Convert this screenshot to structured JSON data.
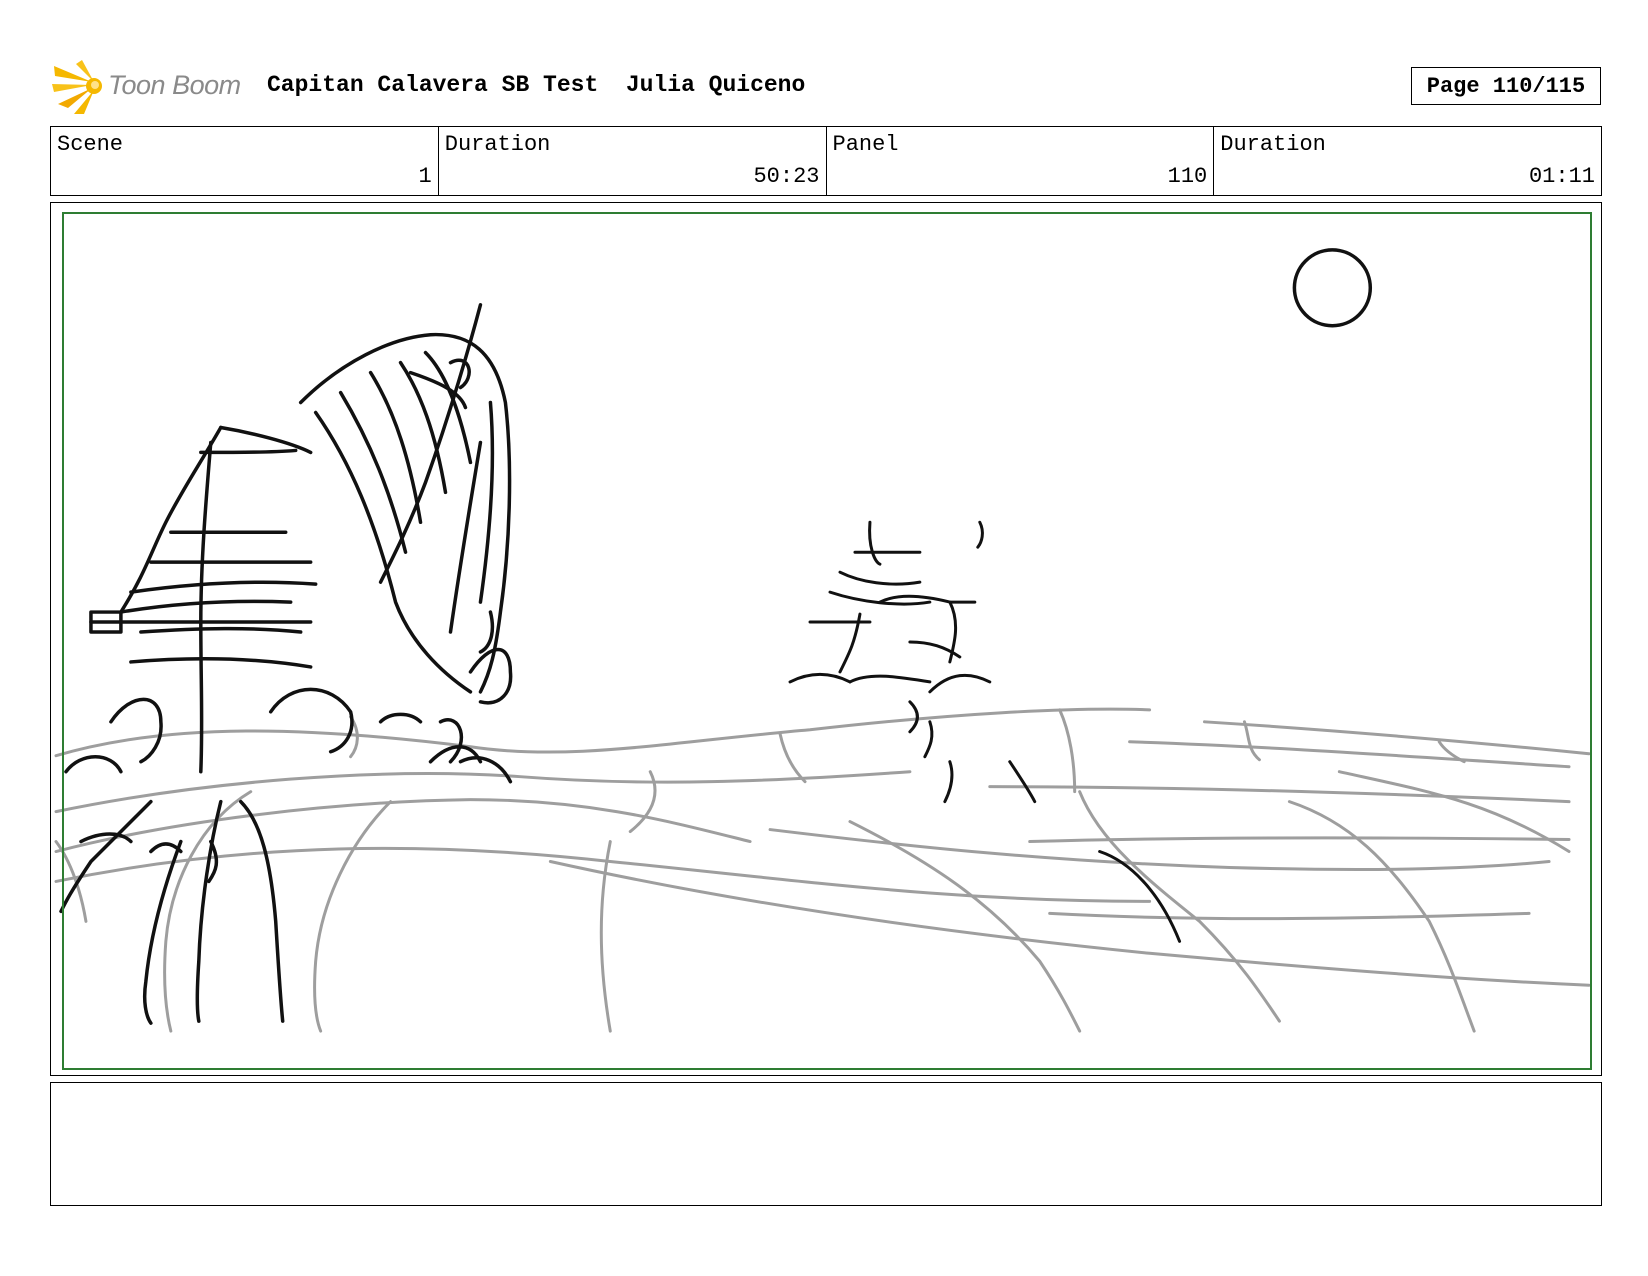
{
  "header": {
    "logo_text": "Toon Boom",
    "title": "Capitan Calavera SB Test  Julia Quiceno",
    "page_label": "Page 110/115"
  },
  "info": {
    "scene_label": "Scene",
    "scene_value": "1",
    "scene_duration_label": "Duration",
    "scene_duration_value": "50:23",
    "panel_label": "Panel",
    "panel_value": "110",
    "panel_duration_label": "Duration",
    "panel_duration_value": "01:11"
  },
  "notes": {
    "text": ""
  },
  "colors": {
    "safe_frame": "#2e7d32",
    "logo_star": "#f5b800",
    "logo_text": "#8a8a8a"
  }
}
